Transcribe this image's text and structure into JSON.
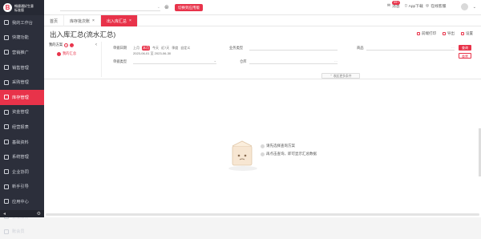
{
  "brand": {
    "mark": "B",
    "name_line1": "畅捷通好生意",
    "name_line2": "标准版"
  },
  "sidebar": {
    "items": [
      {
        "label": "我的工作台",
        "icon": "home-icon"
      },
      {
        "label": "快捷功能",
        "icon": "grid-icon"
      },
      {
        "label": "营销推广",
        "icon": "megaphone-icon"
      },
      {
        "label": "销售管理",
        "icon": "cart-icon"
      },
      {
        "label": "采购管理",
        "icon": "bag-icon"
      },
      {
        "label": "库存管理",
        "icon": "box-icon",
        "active": true
      },
      {
        "label": "资金管理",
        "icon": "wallet-icon"
      },
      {
        "label": "经营报表",
        "icon": "chart-icon"
      },
      {
        "label": "基础资料",
        "icon": "book-icon"
      },
      {
        "label": "系统管理",
        "icon": "gear-icon"
      },
      {
        "label": "企业协同",
        "icon": "link-icon"
      },
      {
        "label": "新手引导",
        "icon": "compass-icon"
      },
      {
        "label": "应用中心",
        "icon": "apps-icon"
      },
      {
        "label": "企业服务",
        "icon": "service-icon"
      },
      {
        "label": "账会员",
        "icon": "user-icon"
      }
    ],
    "collapse_icon": "◂",
    "settings_icon": "⚙"
  },
  "topbar": {
    "store_placeholder": "",
    "switch_label": "切换到应用版",
    "messages_label": "消息",
    "messages_count": "99+",
    "app_label": "App下载",
    "online_label": "在线客服",
    "user_name": ""
  },
  "tabs": [
    {
      "label": "首页"
    },
    {
      "label": "库存批次账",
      "closable": true
    },
    {
      "label": "出入库汇总",
      "closable": true,
      "active": true
    }
  ],
  "page": {
    "title": "出入库汇总(流水汇总)",
    "actions": [
      {
        "label": "前端打印"
      },
      {
        "label": "导出"
      },
      {
        "label": "设置"
      }
    ]
  },
  "plan": {
    "title": "我的方案",
    "add": "+",
    "more": "…",
    "item": "我的汇总"
  },
  "filters": {
    "date_label": "单据日期",
    "quick": [
      "上月",
      "本月",
      "今天",
      "近7天",
      "季度",
      "自定义"
    ],
    "date_range": "2023-06-01 至 2023-06-30",
    "type_label": "单据类型",
    "type_label2": "业务类型",
    "goods_label": "商品",
    "warehouse_label": "仓库",
    "query_label": "查询",
    "reset_label": "重置",
    "expand_label": "收起更多条件"
  },
  "empty": {
    "tip1": "请先选择查询方案",
    "tip2": "再点击查询，即可显示汇总数据"
  }
}
